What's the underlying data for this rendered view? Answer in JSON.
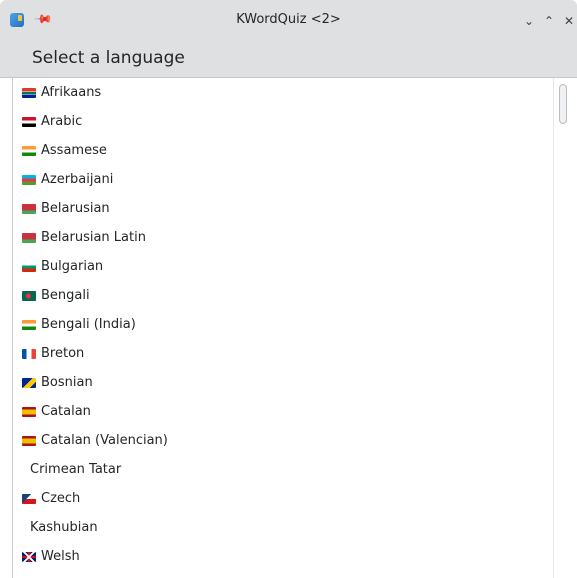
{
  "window": {
    "title": "KWordQuiz <2>",
    "icons": {
      "app": "kwordquiz-app-icon",
      "pin": "pin-icon"
    },
    "controls": {
      "minimize": "⌄",
      "maximize": "⌃",
      "close": "✕"
    }
  },
  "header": {
    "title": "Select a language"
  },
  "languages": [
    {
      "label": "Afrikaans",
      "flag": "za"
    },
    {
      "label": "Arabic",
      "flag": "eg"
    },
    {
      "label": "Assamese",
      "flag": "in"
    },
    {
      "label": "Azerbaijani",
      "flag": "az"
    },
    {
      "label": "Belarusian",
      "flag": "by"
    },
    {
      "label": "Belarusian Latin",
      "flag": "by"
    },
    {
      "label": "Bulgarian",
      "flag": "bg"
    },
    {
      "label": "Bengali",
      "flag": "bd"
    },
    {
      "label": "Bengali (India)",
      "flag": "in"
    },
    {
      "label": "Breton",
      "flag": "fr"
    },
    {
      "label": "Bosnian",
      "flag": "ba"
    },
    {
      "label": "Catalan",
      "flag": "es"
    },
    {
      "label": "Catalan (Valencian)",
      "flag": "es"
    },
    {
      "label": "Crimean Tatar",
      "flag": ""
    },
    {
      "label": "Czech",
      "flag": "cz"
    },
    {
      "label": "Kashubian",
      "flag": ""
    },
    {
      "label": "Welsh",
      "flag": "gb"
    }
  ],
  "colors": {
    "titlebar": "#dee0e2",
    "text": "#232629",
    "list_background": "#ffffff"
  }
}
